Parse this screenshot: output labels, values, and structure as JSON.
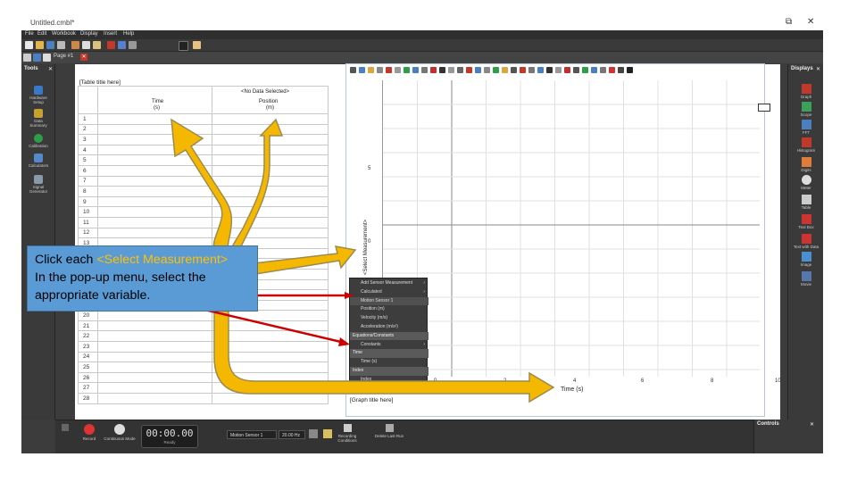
{
  "window": {
    "title": "Untitled.cmbl*",
    "minimize": "—",
    "restore": "⧉",
    "close": "✕"
  },
  "menu": [
    "File",
    "Edit",
    "Workbook",
    "Display",
    "Insert",
    "Help"
  ],
  "page_tab": {
    "label": "Page #1"
  },
  "tools_panel": {
    "title": "Tools",
    "close": "✕",
    "items": [
      {
        "label1": "Hardware",
        "label2": "Setup",
        "color": "#3a78c8"
      },
      {
        "label1": "Data",
        "label2": "Summary",
        "color": "#c8a030"
      },
      {
        "label1": "Calibration",
        "label2": "",
        "color": "#2e9e4a"
      },
      {
        "label1": "Calculators",
        "label2": "",
        "color": "#5588cc"
      },
      {
        "label1": "Signal",
        "label2": "Generator",
        "color": "#8899aa"
      }
    ]
  },
  "displays_panel": {
    "title": "Displays",
    "close": "✕",
    "items": [
      {
        "label": "Graph",
        "color": "#c0392b"
      },
      {
        "label": "Scope",
        "color": "#3aa05a"
      },
      {
        "label": "FFT",
        "color": "#4a80c0"
      },
      {
        "label": "Histogram",
        "color": "#c0392b"
      },
      {
        "label": "Digits",
        "color": "#e07b39"
      },
      {
        "label": "Meter",
        "color": "#dddddd"
      },
      {
        "label": "Table",
        "color": "#cccccc"
      },
      {
        "label": "Text Box",
        "color": "#cc3333"
      },
      {
        "label": "Text with Data",
        "color": "#cc3333"
      },
      {
        "label": "Image",
        "color": "#4a90d0"
      },
      {
        "label": "Movie",
        "color": "#5577aa"
      }
    ]
  },
  "table": {
    "title": "[Table title here]",
    "no_data": "<No Data Selected>",
    "col1": "Time",
    "col1_unit": "(s)",
    "col2": "Position",
    "col2_unit": "(m)",
    "rows": [
      "1",
      "2",
      "3",
      "4",
      "5",
      "6",
      "7",
      "8",
      "9",
      "10",
      "11",
      "12",
      "13",
      "14",
      "15",
      "16",
      "17",
      "18",
      "19",
      "20",
      "21",
      "22",
      "23",
      "24",
      "25",
      "26",
      "27",
      "28"
    ]
  },
  "graph": {
    "y_axis_label": "<Select Measurement>",
    "x_axis_label": "Time (s)",
    "caption": "[Graph title here]",
    "y_ticks": [
      "5",
      "0"
    ],
    "x_ticks": [
      "0",
      "2",
      "4",
      "6",
      "8",
      "10"
    ]
  },
  "popup_menu": {
    "items": [
      {
        "label": "Add Sensor Measurement",
        "type": "item",
        "arrow": "›"
      },
      {
        "label": "Calculated",
        "type": "item",
        "arrow": "›"
      },
      {
        "label": "Motion Sensor 1",
        "type": "sel",
        "arrow": ""
      },
      {
        "label": "Position (m)",
        "type": "item",
        "arrow": ""
      },
      {
        "label": "Velocity (m/s)",
        "type": "item",
        "arrow": ""
      },
      {
        "label": "Acceleration (m/s²)",
        "type": "item",
        "arrow": ""
      },
      {
        "label": "Equations/Constants",
        "type": "hdr",
        "arrow": ""
      },
      {
        "label": "Constants",
        "type": "item",
        "arrow": "›"
      },
      {
        "label": "Time",
        "type": "hdr",
        "arrow": ""
      },
      {
        "label": "Time (s)",
        "type": "item",
        "arrow": ""
      },
      {
        "label": "Index",
        "type": "hdr",
        "arrow": ""
      },
      {
        "label": "Index",
        "type": "item",
        "arrow": ""
      }
    ]
  },
  "callout": {
    "line1_prefix": "Click each ",
    "line1_highlight": "<Select Measurement>",
    "line2": "In the pop-up menu, select the",
    "line3": "appropriate variable."
  },
  "controls": {
    "timer": "00:00.00",
    "timer_status": "Ready",
    "record": "Record",
    "mode": "Continuous Mode",
    "sensor": "Motion Sensor 1",
    "rate": "20.00 Hz",
    "recording_conditions": "Recording Conditions",
    "delete_last_run": "Delete Last Run",
    "panel_title": "Controls",
    "panel_close": "✕"
  },
  "colors": {
    "arrow_fill": "#f5b800",
    "arrow_stroke": "#9c8a50",
    "pointer_line": "#cc0000",
    "callout_bg": "#5b9bd5",
    "highlight_text": "#ffc000"
  }
}
